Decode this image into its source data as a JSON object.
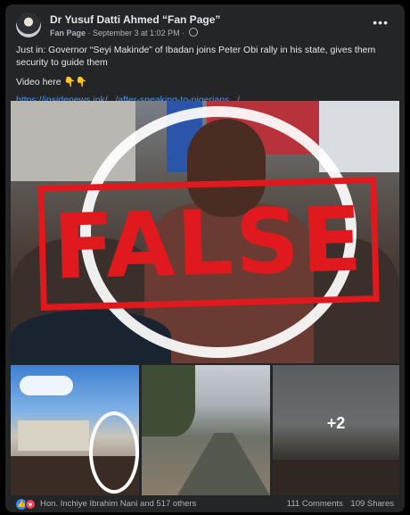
{
  "post": {
    "author": "Dr Yusuf Datti Ahmed “Fan Page”",
    "page_label": "Fan Page",
    "separator": " · ",
    "timestamp": "September 3 at 1:02 PM",
    "dot": " · ",
    "more_icon": "more-horizontal-icon",
    "text_line": "Just in: Governor “Seyi Makinde” of Ibadan joins Peter Obi rally in his state, gives them security to guide them",
    "text_video": "Video here 👇👇",
    "link": "https://insidenews.ink/.../after-speaking-to-nigerians.../"
  },
  "main_image": {
    "stamp_text": "FALSE",
    "stamp_color": "#e0191f"
  },
  "thumbnails": {
    "more_count": "+2"
  },
  "footer": {
    "reactors": "Hon. Inchiye Ibrahim Nani and 517 others",
    "comments": "111 Comments",
    "shares": "109 Shares"
  },
  "colors": {
    "card_bg": "#242526",
    "link": "#4599ff",
    "like": "#2d86ff",
    "love": "#f33e58"
  }
}
